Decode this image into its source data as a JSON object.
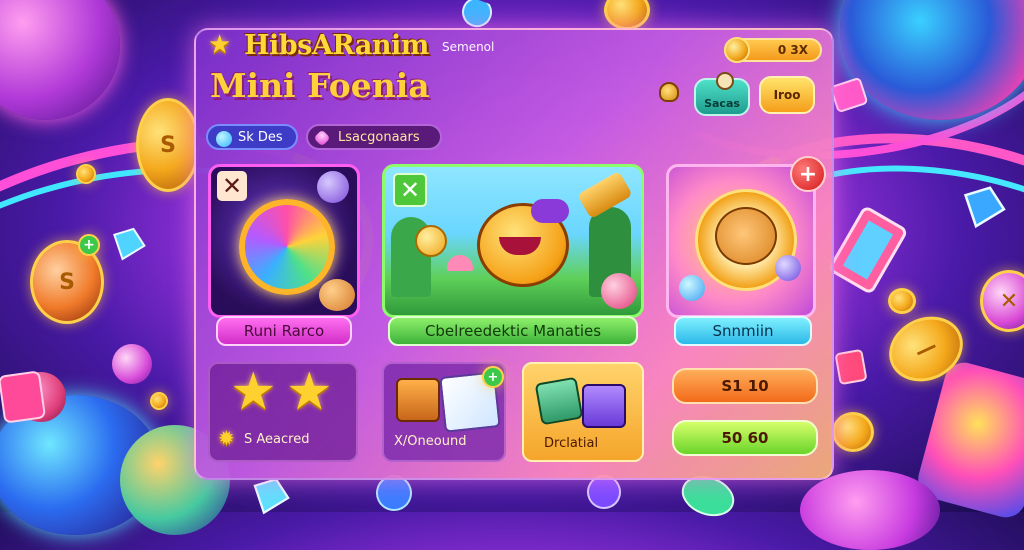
{
  "header": {
    "logo_line1": "HibsARanim",
    "logo_line2": "Mini Foenia",
    "small_label": "Semenol",
    "coins": "0 3X",
    "teal_button": "Sacas",
    "orange_button": "Iroo"
  },
  "filters": {
    "pill1": "Sk Des",
    "pill2": "Lsacgonaars"
  },
  "cards": [
    {
      "label": "Runi Rarco",
      "close": "✕"
    },
    {
      "label": "Cbelreedektic Manaties",
      "close": "✕"
    },
    {
      "label": "Snnmiin",
      "close": "+"
    }
  ],
  "bottom": {
    "stars_text": "S Aeacred",
    "chest_text": "X/Oneound",
    "box_text": "Drclatial",
    "value1": "S1 10",
    "value2": "50 60",
    "chest_badge": "+"
  },
  "colors": {
    "gold": "#ffd23a",
    "panel_purple": "#7a2ec8",
    "pink_label": "#f14ee0",
    "green_label": "#5fd44a",
    "teal_label": "#4fd6f0"
  }
}
